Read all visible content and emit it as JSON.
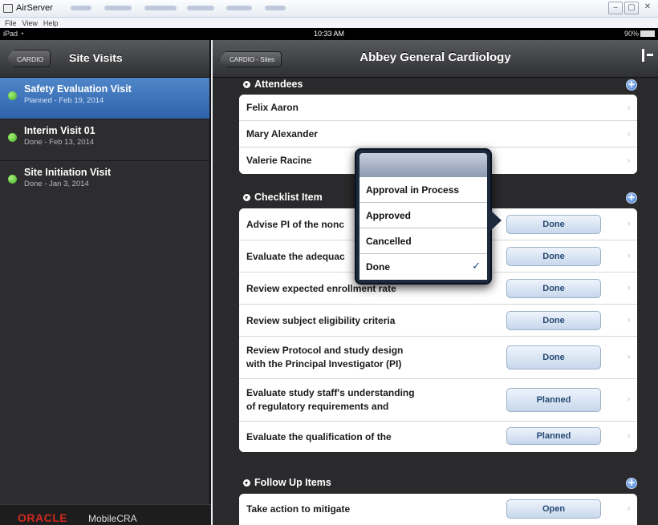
{
  "window": {
    "title": "AirServer",
    "menu": [
      "File",
      "View",
      "Help"
    ],
    "buttons": [
      "‒",
      "▢",
      "✕"
    ]
  },
  "statusbar": {
    "device": "iPad",
    "time": "10:33 AM",
    "battery": "90%"
  },
  "left": {
    "back_label": "CARDIO",
    "title": "Site Visits",
    "visits": [
      {
        "title": "Safety Evaluation Visit",
        "subtitle": "Planned - Feb 19, 2014",
        "status_color": "#3fae24"
      },
      {
        "title": "Interim Visit 01",
        "subtitle": "Done - Feb 13, 2014",
        "status_color": "#3fae24"
      },
      {
        "title": "Site Initiation Visit",
        "subtitle": "Done - Jan 3, 2014",
        "status_color": "#3fae24"
      }
    ],
    "footer_brand": "ORACLE",
    "footer_product": "MobileCRA"
  },
  "right": {
    "back_label": "CARDIO - Sites",
    "title": "Abbey General Cardiology",
    "attendees": {
      "header": "Attendees",
      "items": [
        "Felix Aaron",
        "Mary Alexander",
        "Valerie Racine"
      ]
    },
    "checklist": {
      "header": "Checklist Item",
      "items": [
        {
          "label": "Advise PI of the nonc",
          "status": "Done"
        },
        {
          "label": "Evaluate the adequac",
          "status": "Done"
        },
        {
          "label": "Review expected enrollment rate",
          "status": "Done"
        },
        {
          "label": "Review subject eligibility criteria",
          "status": "Done"
        },
        {
          "label1": "Review Protocol and study design",
          "label2": "with the Principal Investigator (PI)",
          "status": "Done"
        },
        {
          "label1": "Evaluate study staff's understanding",
          "label2": "of regulatory requirements and",
          "status": "Planned"
        },
        {
          "label": "Evaluate the qualification of the",
          "status": "Planned"
        }
      ]
    },
    "followup": {
      "header": "Follow Up Items",
      "items": [
        {
          "label": "Take action to mitigate",
          "status": "Open"
        }
      ]
    }
  },
  "popover": {
    "options": [
      "Approval in Process",
      "Approved",
      "Cancelled",
      "Done"
    ],
    "selected": "Done",
    "check": "✓"
  },
  "colors": {
    "selected_row": "#3f77bd",
    "status_dot": "#3fae24",
    "oracle_red": "#d02a1e"
  }
}
